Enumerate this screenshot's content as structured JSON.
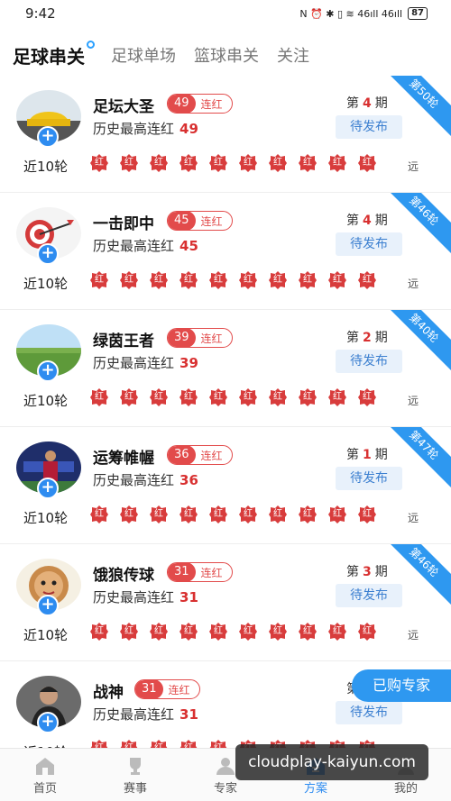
{
  "status_bar": {
    "time": "9:42",
    "icons": "N ⏰ ✱ ▯ ≋ 46ıll 46ıll",
    "battery": "87"
  },
  "tabs": [
    {
      "label": "足球串关",
      "active": true
    },
    {
      "label": "足球单场",
      "active": false
    },
    {
      "label": "篮球串关",
      "active": false
    },
    {
      "label": "关注",
      "active": false
    }
  ],
  "experts": [
    {
      "name": "足坛大圣",
      "streak": "49",
      "streak_label": "连红",
      "history_label": "历史最高连红",
      "history_value": "49",
      "period_prefix": "第",
      "period": "4",
      "period_suffix": "期",
      "status": "待发布",
      "round": "第50轮",
      "recent_label": "近10轮",
      "result_text": "红",
      "more": "远"
    },
    {
      "name": "一击即中",
      "streak": "45",
      "streak_label": "连红",
      "history_label": "历史最高连红",
      "history_value": "45",
      "period_prefix": "第",
      "period": "4",
      "period_suffix": "期",
      "status": "待发布",
      "round": "第46轮",
      "recent_label": "近10轮",
      "result_text": "红",
      "more": "远"
    },
    {
      "name": "绿茵王者",
      "streak": "39",
      "streak_label": "连红",
      "history_label": "历史最高连红",
      "history_value": "39",
      "period_prefix": "第",
      "period": "2",
      "period_suffix": "期",
      "status": "待发布",
      "round": "第40轮",
      "recent_label": "近10轮",
      "result_text": "红",
      "more": "远"
    },
    {
      "name": "运筹帷幄",
      "streak": "36",
      "streak_label": "连红",
      "history_label": "历史最高连红",
      "history_value": "36",
      "period_prefix": "第",
      "period": "1",
      "period_suffix": "期",
      "status": "待发布",
      "round": "第47轮",
      "recent_label": "近10轮",
      "result_text": "红",
      "more": "远"
    },
    {
      "name": "饿狼传球",
      "streak": "31",
      "streak_label": "连红",
      "history_label": "历史最高连红",
      "history_value": "31",
      "period_prefix": "第",
      "period": "3",
      "period_suffix": "期",
      "status": "待发布",
      "round": "第46轮",
      "recent_label": "近10轮",
      "result_text": "红",
      "more": "远"
    },
    {
      "name": "战神",
      "streak": "31",
      "streak_label": "连红",
      "history_label": "历史最高连红",
      "history_value": "31",
      "period_prefix": "第",
      "period": "",
      "period_suffix": "",
      "status": "待发布",
      "round": "",
      "recent_label": "近10轮",
      "result_text": "红",
      "more": ""
    }
  ],
  "floating_button": "已购专家",
  "bottom_nav": [
    {
      "label": "首页",
      "icon": "home-icon",
      "active": false
    },
    {
      "label": "赛事",
      "icon": "trophy-icon",
      "active": false
    },
    {
      "label": "专家",
      "icon": "expert-icon",
      "active": false
    },
    {
      "label": "方案",
      "icon": "plan-icon",
      "active": true
    },
    {
      "label": "我的",
      "icon": "profile-icon",
      "active": false
    }
  ],
  "watermark": "cloudplay-kaiyun.com",
  "colors": {
    "accent": "#2e98f0",
    "red": "#e24b4b"
  }
}
